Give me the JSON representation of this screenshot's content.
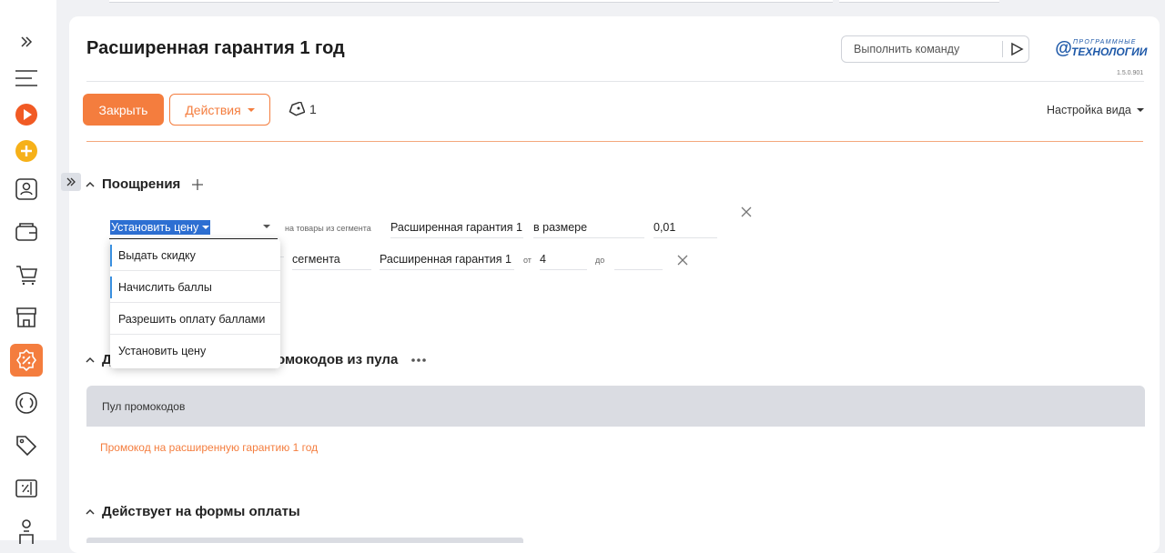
{
  "page": {
    "title": "Расширенная гарантия 1 год",
    "command_placeholder": "Выполнить команду",
    "logo_top": "ПРОГРАММНЫЕ",
    "logo_main": "ТЕХНОЛОГИИ",
    "version": "1.5.0.901"
  },
  "toolbar": {
    "close_label": "Закрыть",
    "actions_label": "Действия",
    "tag_count": "1",
    "view_settings_label": "Настройка вида"
  },
  "incentives": {
    "heading": "Поощрения",
    "row1": {
      "action_selected": "Установить цену",
      "small_label": "на товары из сегмента",
      "segment": "Расширенная гарантия 1",
      "size_label": "в размере",
      "value": "0,01"
    },
    "row2": {
      "segment_label": "сегмента",
      "segment": "Расширенная гарантия 1",
      "from_label": "от",
      "from_value": "4",
      "to_label": "до",
      "to_value": ""
    },
    "dropdown_options": [
      "Выдать скидку",
      "Начислить баллы",
      "Разрешить оплату баллами",
      "Установить цену"
    ]
  },
  "promo_section": {
    "heading_visible_part": "Д",
    "heading_visible_end": "омокодов из пула",
    "pool_header": "Пул промокодов",
    "pool_item": "Промокод на расширенную гарантию 1 год"
  },
  "payment_section": {
    "heading": "Действует на формы оплаты"
  },
  "colors": {
    "accent": "#f47d3e",
    "selection": "#2d6fd2",
    "logo": "#1d58a8"
  },
  "icons": {
    "sidebar": [
      "expand-icon",
      "menu-icon",
      "play-icon",
      "plus-circle-icon",
      "contact-card-icon",
      "wallet-icon",
      "cart-icon",
      "store-icon",
      "promotion-icon",
      "refresh-circle-icon",
      "tag-icon",
      "coupon-icon",
      "person-icon"
    ]
  }
}
